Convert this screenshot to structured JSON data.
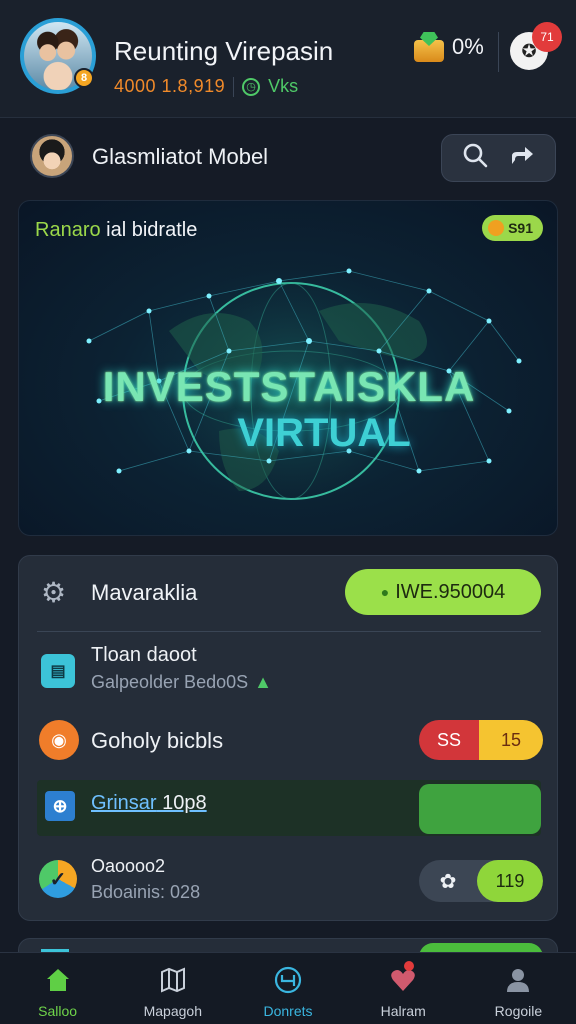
{
  "header": {
    "title": "Reunting Virepasin",
    "stat_primary": "4000 1.8,919",
    "stat_secondary": "Vks",
    "coins": "0%",
    "notification_count": "71",
    "avatar_badge": "8"
  },
  "subheader": {
    "title": "Glasmliatot Mobel",
    "actions": [
      "search-icon",
      "share-icon"
    ]
  },
  "hero": {
    "caption_highlight": "Ranaro",
    "caption_rest": " ial bidratle",
    "badge": "S91",
    "headline_1": "INVESTSTAISKLA",
    "headline_2": "VIRTUAL"
  },
  "card": {
    "header_label": "Mavaraklia",
    "header_value": "IWE.950004",
    "items": [
      {
        "title": "Tloan daoot",
        "subtitle": "Galpeolder Bedo0S"
      },
      {
        "title": "Goholy bicbls",
        "pill_left": "SS",
        "pill_right": "15"
      },
      {
        "title_link": "Grinsar",
        "title_tail": " 10p8"
      },
      {
        "title": "Oaoooo2",
        "subtitle": "Bdoainis: 028",
        "pill_value": "119"
      }
    ]
  },
  "tabbar": {
    "tabs": [
      {
        "label": "Salloo",
        "icon": "home-icon",
        "active": true
      },
      {
        "label": "Mapagoh",
        "icon": "map-icon",
        "active": false
      },
      {
        "label": "Donrets",
        "icon": "wallet-icon",
        "active": false
      },
      {
        "label": "Halram",
        "icon": "heart-icon",
        "active": false
      },
      {
        "label": "Rogoile",
        "icon": "profile-icon",
        "active": false
      }
    ]
  },
  "colors": {
    "background": "#151b26",
    "accent_green": "#9be04a",
    "accent_orange": "#f07d2a",
    "accent_red": "#d2363a",
    "accent_yellow": "#f5c430",
    "accent_cyan": "#3ed0d4"
  }
}
